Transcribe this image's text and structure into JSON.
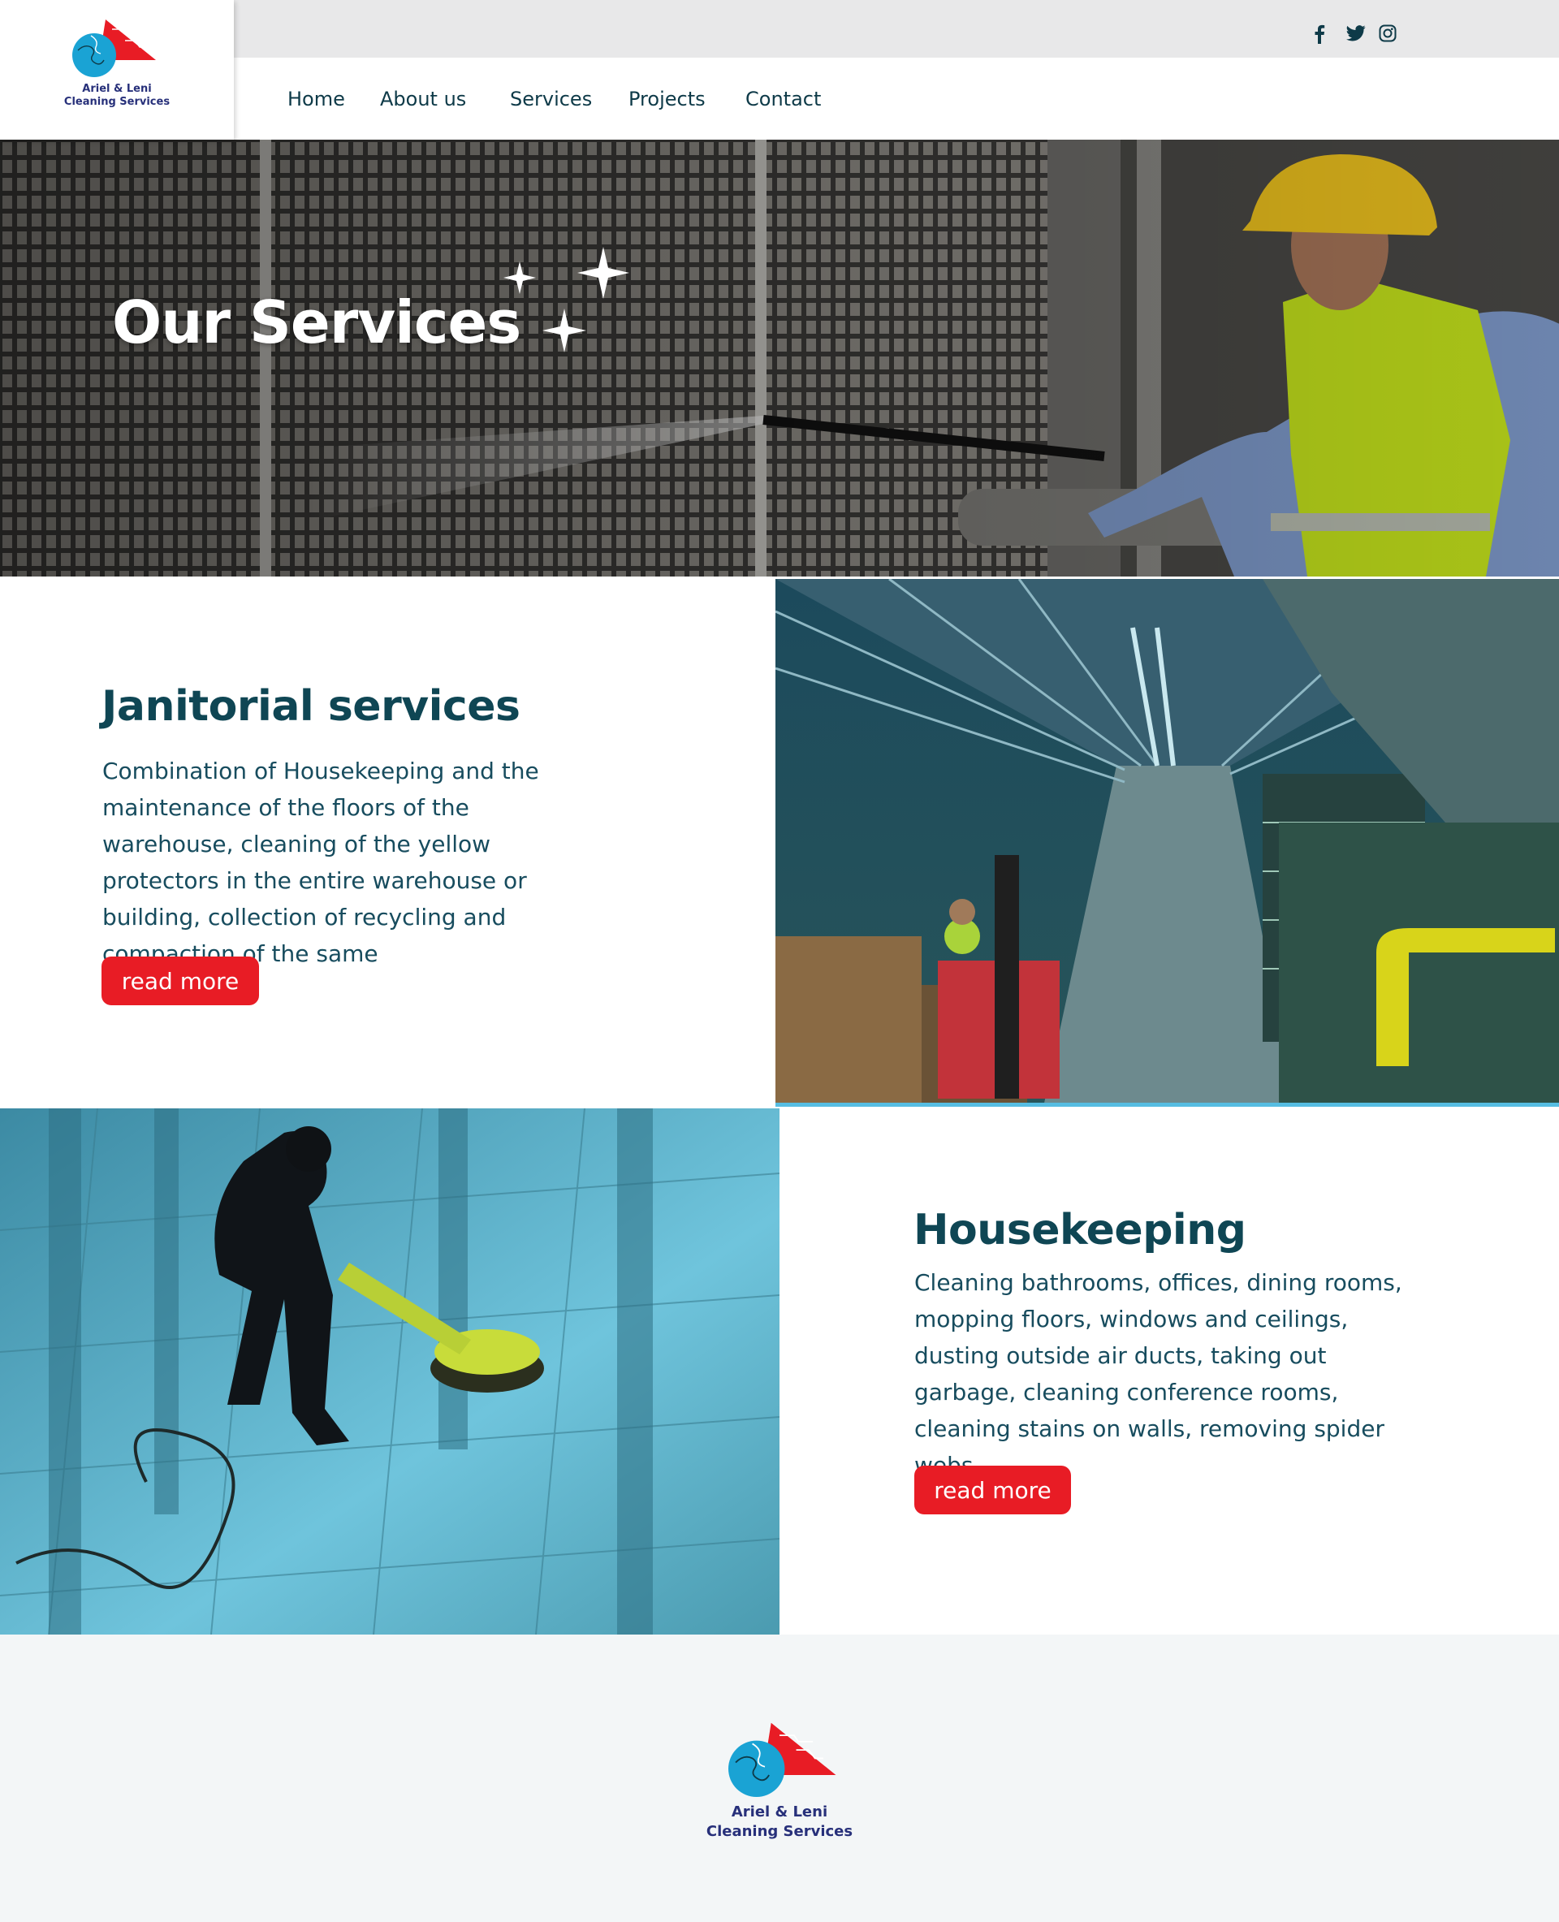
{
  "brand": {
    "name_line1": "Ariel & Leni",
    "name_line2": "Cleaning Services",
    "colors": {
      "primary_dark": "#0f4654",
      "accent_red": "#e81c25",
      "logo_blue": "#1aa3d4",
      "logo_navy": "#27307a"
    }
  },
  "header": {
    "social": [
      {
        "icon": "facebook-icon"
      },
      {
        "icon": "twitter-icon"
      },
      {
        "icon": "instagram-icon"
      }
    ],
    "nav": [
      {
        "label": "Home"
      },
      {
        "label": "About us"
      },
      {
        "label": "Services"
      },
      {
        "label": "Projects"
      },
      {
        "label": "Contact"
      }
    ]
  },
  "hero": {
    "title": "Our Services",
    "image": "worker pressure-washing industrial grille",
    "decoration": "sparkle-icons"
  },
  "services": [
    {
      "title": "Janitorial services",
      "description": "Combination of Housekeeping and the maintenance of the floors of the warehouse, cleaning of the yellow protectors in the entire warehouse or building, collection of recycling and compaction of the same",
      "button_label": "read more",
      "image": "warehouse aisle with forklift and compactor"
    },
    {
      "title": "Housekeeping",
      "description": "Cleaning bathrooms, offices, dining rooms, mopping floors, windows and ceilings, dusting outside air ducts, taking out garbage, cleaning conference rooms, cleaning stains on walls, removing spider webs",
      "button_label": "read more",
      "image": "person polishing floor with buffer machine"
    }
  ],
  "footer": {
    "name_line1": "Ariel & Leni",
    "name_line2": "Cleaning Services"
  }
}
